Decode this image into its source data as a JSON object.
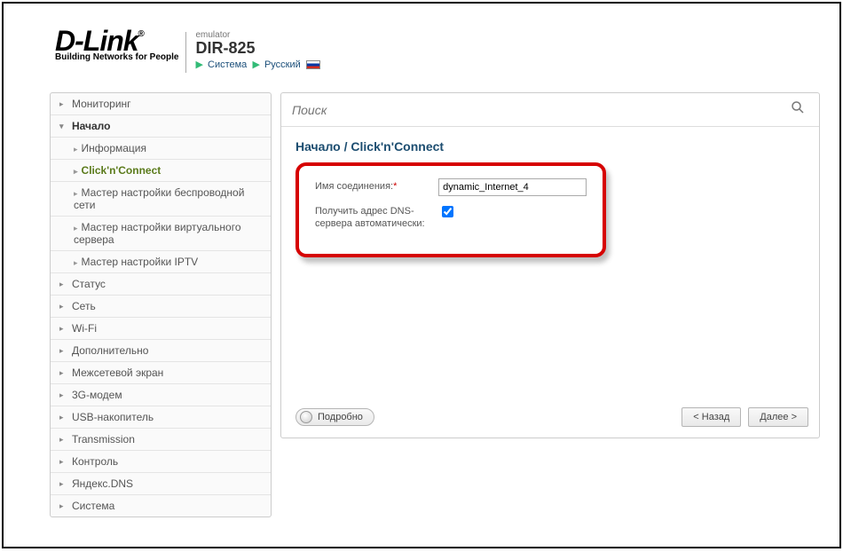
{
  "header": {
    "brand": "D-Link",
    "reg": "®",
    "tagline": "Building Networks for People",
    "emulator": "emulator",
    "device": "DIR-825",
    "menu_system": "Система",
    "menu_lang": "Русский"
  },
  "sidebar": {
    "items": [
      {
        "label": "Мониторинг",
        "arrow": "▸"
      },
      {
        "label": "Начало",
        "arrow": "▾",
        "active": true
      },
      {
        "label": "Статус",
        "arrow": "▸"
      },
      {
        "label": "Сеть",
        "arrow": "▸"
      },
      {
        "label": "Wi-Fi",
        "arrow": "▸"
      },
      {
        "label": "Дополнительно",
        "arrow": "▸"
      },
      {
        "label": "Межсетевой экран",
        "arrow": "▸"
      },
      {
        "label": "3G-модем",
        "arrow": "▸"
      },
      {
        "label": "USB-накопитель",
        "arrow": "▸"
      },
      {
        "label": "Transmission",
        "arrow": "▸"
      },
      {
        "label": "Контроль",
        "arrow": "▸"
      },
      {
        "label": "Яндекс.DNS",
        "arrow": "▸"
      },
      {
        "label": "Система",
        "arrow": "▸"
      }
    ],
    "subs": [
      {
        "label": "Информация"
      },
      {
        "label": "Click'n'Connect",
        "selected": true
      },
      {
        "label": "Мастер настройки беспроводной сети"
      },
      {
        "label": "Мастер настройки виртуального сервера"
      },
      {
        "label": "Мастер настройки IPTV"
      }
    ]
  },
  "search": {
    "placeholder": "Поиск"
  },
  "breadcrumb": "Начало /  Click'n'Connect",
  "form": {
    "conn_label": "Имя соединения:",
    "conn_value": "dynamic_Internet_4",
    "dns_label": "Получить адрес DNS-сервера автоматически:",
    "dns_checked": true
  },
  "buttons": {
    "details": "Подробно",
    "back": "< Назад",
    "next": "Далее >"
  }
}
